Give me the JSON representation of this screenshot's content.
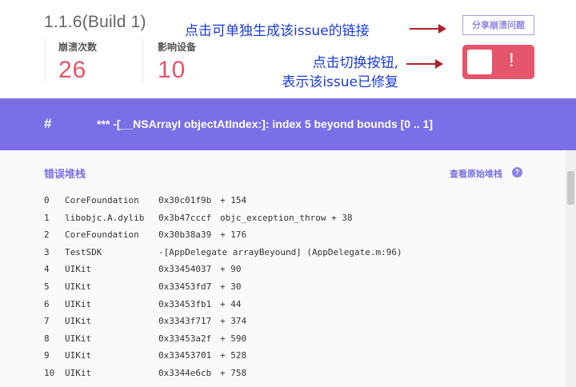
{
  "header": {
    "version": "1.1.6(Build 1)",
    "crash_count_label": "崩溃次数",
    "crash_count_value": "26",
    "devices_label": "影响设备",
    "devices_value": "10",
    "share_button": "分享崩溃问题",
    "toggle_mark": "!"
  },
  "annotations": {
    "share_note": "点击可单独生成该issue的链接",
    "toggle_note_line1": "点击切换按钮,",
    "toggle_note_line2": "表示该issue已修复"
  },
  "issue": {
    "hash": "#",
    "message": "*** -[__NSArrayI objectAtIndex:]: index 5 beyond bounds [0 .. 1]"
  },
  "stack": {
    "title": "错误堆栈",
    "view_raw": "查看原始堆栈",
    "help_icon": "?",
    "frames": [
      {
        "idx": "0",
        "lib": "CoreFoundation",
        "addr": "0x30c01f9b",
        "off": "+ 154"
      },
      {
        "idx": "1",
        "lib": "libobjc.A.dylib",
        "addr": "0x3b47cccf",
        "off": "objc_exception_throw + 38"
      },
      {
        "idx": "2",
        "lib": "CoreFoundation",
        "addr": "0x30b38a39",
        "off": "+ 176"
      },
      {
        "idx": "3",
        "lib": "TestSDK",
        "addr": "-[AppDelegate arrayBeyound] (AppDelegate.m:96)",
        "off": ""
      },
      {
        "idx": "4",
        "lib": "UIKit",
        "addr": "0x33454037",
        "off": "+ 90"
      },
      {
        "idx": "5",
        "lib": "UIKit",
        "addr": "0x33453fd7",
        "off": "+ 30"
      },
      {
        "idx": "6",
        "lib": "UIKit",
        "addr": "0x33453fb1",
        "off": "+ 44"
      },
      {
        "idx": "7",
        "lib": "UIKit",
        "addr": "0x3343f717",
        "off": "+ 374"
      },
      {
        "idx": "8",
        "lib": "UIKit",
        "addr": "0x33453a2f",
        "off": "+ 590"
      },
      {
        "idx": "9",
        "lib": "UIKit",
        "addr": "0x33453701",
        "off": "+ 528"
      },
      {
        "idx": "10",
        "lib": "UIKit",
        "addr": "0x3344e6cb",
        "off": "+ 758"
      }
    ]
  },
  "colors": {
    "accent": "#7a6fe6",
    "danger": "#e5556b",
    "annotation_text": "#1a3ad6",
    "annotation_arrow": "#b0202a"
  }
}
